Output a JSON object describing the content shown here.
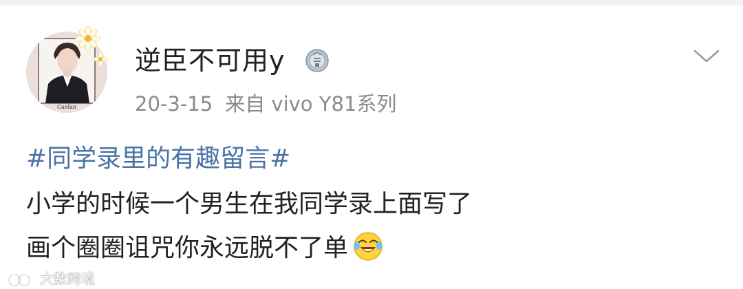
{
  "post": {
    "avatar_caption": "Caelan",
    "username": "逆臣不可用y",
    "badge_icon": "vip-medal-icon",
    "date": "20-3-15",
    "source": "来自 vivo Y81系列",
    "menu_icon": "chevron-down-icon",
    "hashtag": "#同学录里的有趣留言#",
    "text_line1": "小学的时候一个男生在我同学录上面写了",
    "text_line2": "画个圈圈诅咒你永远脱不了单",
    "emoji": "laughing-crying-emoji"
  },
  "watermark": {
    "text": "大数跨境"
  },
  "colors": {
    "hashtag": "#4a74a5",
    "text": "#222222",
    "meta": "#8a8a8a",
    "avatar_bg": "#eadfdb",
    "top_strip": "#f2f2f2"
  }
}
